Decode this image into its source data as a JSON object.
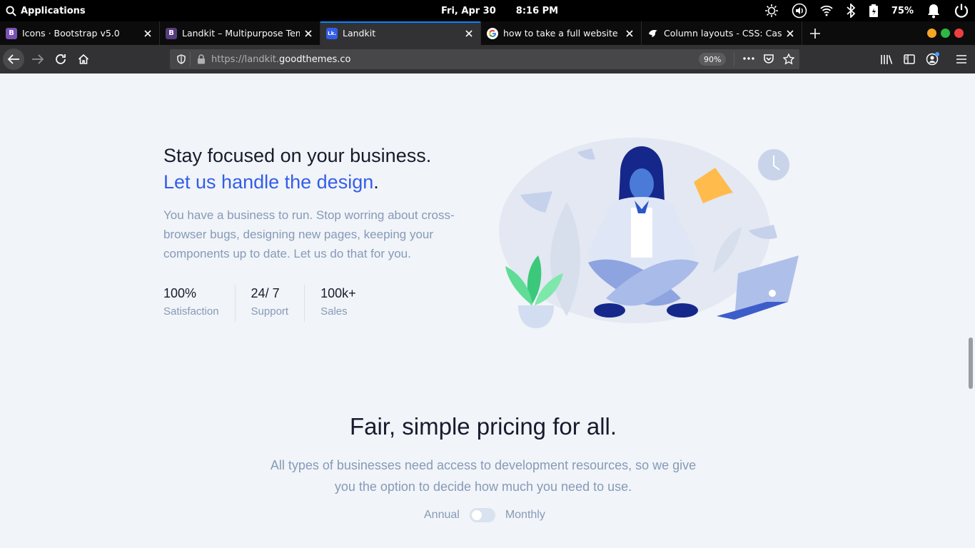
{
  "os": {
    "menu_label": "Applications",
    "date": "Fri, Apr 30",
    "time": "8:16 PM",
    "battery": "75%"
  },
  "tabs": [
    {
      "favicon": "B",
      "favicon_color": "#7952b3",
      "title": "Icons · Bootstrap v5.0",
      "active": false
    },
    {
      "favicon": "B",
      "favicon_color": "#563d7c",
      "title": "Landkit – Multipurpose Temp",
      "active": false
    },
    {
      "favicon": "Lk.",
      "favicon_color": "#335eea",
      "title": "Landkit",
      "active": true
    },
    {
      "favicon": "G",
      "favicon_color": "#ffffff",
      "title": "how to take a full website scr",
      "active": false
    },
    {
      "favicon": "mdn",
      "favicon_color": "#0c0c0d",
      "title": "Column layouts - CSS: Cascad",
      "active": false
    }
  ],
  "urlbar": {
    "url_prefix": "https://landkit.",
    "url_domain": "goodthemes.co",
    "zoom": "90%"
  },
  "content": {
    "heading_line1": "Stay focused on your business.",
    "heading_line2": "Let us handle the design",
    "heading_period": ".",
    "lead": "You have a business to run. Stop worring about cross-browser bugs, designing new pages, keeping your components up to date. Let us do that for you.",
    "stats": [
      {
        "value": "100%",
        "label": "Satisfaction"
      },
      {
        "value": "24/ 7",
        "label": "Support"
      },
      {
        "value": "100k+",
        "label": "Sales"
      }
    ],
    "pricing_title": "Fair, simple pricing for all.",
    "pricing_lead": "All types of businesses need access to development resources, so we give you the option to decide how much you need to use.",
    "toggle_left": "Annual",
    "toggle_right": "Monthly"
  },
  "colors": {
    "primary": "#335eea",
    "heading": "#161c2d",
    "muted": "#869ab8",
    "page_bg": "#f1f4f8"
  }
}
